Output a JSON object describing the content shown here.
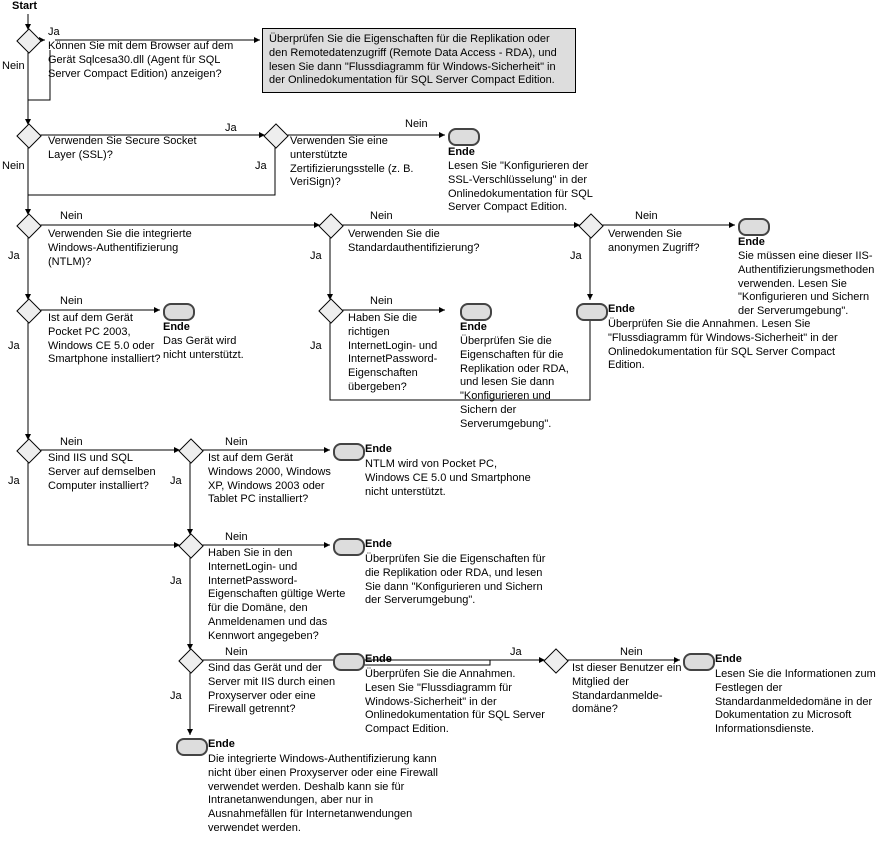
{
  "labels": {
    "start": "Start",
    "ja": "Ja",
    "nein": "Nein",
    "ende": "Ende"
  },
  "nodes": {
    "q1": "Können Sie mit dem Browser auf dem Gerät Sqlcesa30.dll (Agent für SQL Server Compact Edition) anzeigen?",
    "box1": "Überprüfen Sie die Eigenschaften für die Replikation oder den Remotedatenzugriff (Remote Data Access - RDA), und lesen Sie dann \"Flussdiagramm für Windows-Sicherheit\" in der Onlinedokumentation für SQL Server Compact Edition.",
    "q2": "Verwenden Sie Secure Socket Layer (SSL)?",
    "q3": "Verwenden Sie eine unterstützte Zertifizierungsstelle (z. B. VeriSign)?",
    "e1": "Lesen Sie \"Konfigurieren der SSL-Verschlüsselung\" in der Onlinedokumentation für SQL Server Compact Edition.",
    "q4": "Verwenden Sie die integrierte Windows-Authentifizierung (NTLM)?",
    "q5": "Verwenden Sie die Standardauthentifizierung?",
    "q6": "Verwenden Sie anonymen Zugriff?",
    "e2": "Sie müssen eine dieser IIS-Authentifizierungsmethoden verwenden. Lesen Sie \"Konfigurieren und Sichern der Serverumgebung\".",
    "q7": "Ist auf dem Gerät Pocket PC 2003, Windows CE 5.0 oder Smartphone installiert?",
    "e3": "Das Gerät wird nicht unterstützt.",
    "q8": "Haben Sie die richtigen InternetLogin- und InternetPassword-Eigenschaften übergeben?",
    "e4": "Überprüfen Sie die Eigenschaften für die Replikation oder RDA, und lesen Sie dann \"Konfigurieren und Sichern der Serverumgebung\".",
    "e5": "Überprüfen Sie die Annahmen. Lesen Sie \"Flussdiagramm für Windows-Sicherheit\" in der Onlinedokumentation für SQL Server Compact Edition.",
    "q9": "Sind IIS und SQL Server auf demselben Computer installiert?",
    "q10": "Ist auf dem Gerät Windows 2000, Windows XP, Windows 2003 oder Tablet PC installiert?",
    "e6": "NTLM wird von Pocket PC, Windows CE 5.0 und Smartphone nicht unterstützt.",
    "q11": "Haben Sie in den InternetLogin- und InternetPassword-Eigenschaften gültige Werte für die Domäne, den Anmeldenamen und das Kennwort angegeben?",
    "e7": "Überprüfen Sie die Eigenschaften für die Replikation oder RDA, und lesen Sie dann \"Konfigurieren und Sichern der Serverumgebung\".",
    "q12": "Sind das Gerät und der Server mit IIS durch einen Proxyserver oder eine Firewall getrennt?",
    "q13": "Ist dieser Benutzer ein Mitglied der Standardanmelde­domäne?",
    "e8": "Überprüfen Sie die Annahmen. Lesen Sie \"Flussdiagramm für Windows-Sicherheit\" in der Onlinedokumentation für SQL Server Compact Edition.",
    "e9": "Lesen Sie die Informationen zum Festlegen der Standardanmeldedomäne in der Dokumentation zu Microsoft Informationsdienste.",
    "e10": "Die integrierte Windows-Authentifizierung kann nicht über einen Proxyserver oder eine Firewall verwendet werden. Deshalb kann sie für Intranetanwendungen, aber nur in Ausnahmefällen für Internetanwendungen verwendet werden."
  },
  "chart_data": {
    "type": "flowchart",
    "title": "Flussdiagramm für Windows-Sicherheit (SQL Server Compact Edition)",
    "nodes": [
      {
        "id": "start",
        "kind": "start",
        "label": "Start"
      },
      {
        "id": "d0",
        "kind": "decision",
        "label": ""
      },
      {
        "id": "q1",
        "kind": "decision",
        "label": "Können Sie mit dem Browser auf dem Gerät Sqlcesa30.dll (Agent für SQL Server Compact Edition) anzeigen?"
      },
      {
        "id": "box1",
        "kind": "process",
        "label": "Überprüfen Sie die Eigenschaften für die Replikation oder den Remotedatenzugriff (Remote Data Access - RDA), und lesen Sie dann \"Flussdiagramm für Windows-Sicherheit\" in der Onlinedokumentation für SQL Server Compact Edition."
      },
      {
        "id": "q2",
        "kind": "decision",
        "label": "Verwenden Sie Secure Socket Layer (SSL)?"
      },
      {
        "id": "q3",
        "kind": "decision",
        "label": "Verwenden Sie eine unterstützte Zertifizierungsstelle (z. B. VeriSign)?"
      },
      {
        "id": "e1",
        "kind": "terminator",
        "label": "Ende",
        "note": "Lesen Sie \"Konfigurieren der SSL-Verschlüsselung\" in der Onlinedokumentation für SQL Server Compact Edition."
      },
      {
        "id": "q4",
        "kind": "decision",
        "label": "Verwenden Sie die integrierte Windows-Authentifizierung (NTLM)?"
      },
      {
        "id": "q5",
        "kind": "decision",
        "label": "Verwenden Sie die Standardauthentifizierung?"
      },
      {
        "id": "q6",
        "kind": "decision",
        "label": "Verwenden Sie anonymen Zugriff?"
      },
      {
        "id": "e2",
        "kind": "terminator",
        "label": "Ende",
        "note": "Sie müssen eine dieser IIS-Authentifizierungsmethoden verwenden. Lesen Sie \"Konfigurieren und Sichern der Serverumgebung\"."
      },
      {
        "id": "q7",
        "kind": "decision",
        "label": "Ist auf dem Gerät Pocket PC 2003, Windows CE 5.0 oder Smartphone installiert?"
      },
      {
        "id": "e3",
        "kind": "terminator",
        "label": "Ende",
        "note": "Das Gerät wird nicht unterstützt."
      },
      {
        "id": "q8",
        "kind": "decision",
        "label": "Haben Sie die richtigen InternetLogin- und InternetPassword-Eigenschaften übergeben?"
      },
      {
        "id": "e4",
        "kind": "terminator",
        "label": "Ende",
        "note": "Überprüfen Sie die Eigenschaften für die Replikation oder RDA, und lesen Sie dann \"Konfigurieren und Sichern der Serverumgebung\"."
      },
      {
        "id": "e5",
        "kind": "terminator",
        "label": "Ende",
        "note": "Überprüfen Sie die Annahmen. Lesen Sie \"Flussdiagramm für Windows-Sicherheit\" in der Onlinedokumentation für SQL Server Compact Edition."
      },
      {
        "id": "q9",
        "kind": "decision",
        "label": "Sind IIS und SQL Server auf demselben Computer installiert?"
      },
      {
        "id": "q10",
        "kind": "decision",
        "label": "Ist auf dem Gerät Windows 2000, Windows XP, Windows 2003 oder Tablet PC installiert?"
      },
      {
        "id": "e6",
        "kind": "terminator",
        "label": "Ende",
        "note": "NTLM wird von Pocket PC, Windows CE 5.0 und Smartphone nicht unterstützt."
      },
      {
        "id": "q11",
        "kind": "decision",
        "label": "Haben Sie in den InternetLogin- und InternetPassword-Eigenschaften gültige Werte für die Domäne, den Anmeldenamen und das Kennwort angegeben?"
      },
      {
        "id": "e7",
        "kind": "terminator",
        "label": "Ende",
        "note": "Überprüfen Sie die Eigenschaften für die Replikation oder RDA, und lesen Sie dann \"Konfigurieren und Sichern der Serverumgebung\"."
      },
      {
        "id": "q12",
        "kind": "decision",
        "label": "Sind das Gerät und der Server mit IIS durch einen Proxyserver oder eine Firewall getrennt?"
      },
      {
        "id": "q13",
        "kind": "decision",
        "label": "Ist dieser Benutzer ein Mitglied der Standardanmeldedomäne?"
      },
      {
        "id": "e8",
        "kind": "terminator",
        "label": "Ende",
        "note": "Überprüfen Sie die Annahmen. Lesen Sie \"Flussdiagramm für Windows-Sicherheit\" in der Onlinedokumentation für SQL Server Compact Edition."
      },
      {
        "id": "e9",
        "kind": "terminator",
        "label": "Ende",
        "note": "Lesen Sie die Informationen zum Festlegen der Standardanmeldedomäne in der Dokumentation zu Microsoft Informationsdienste."
      },
      {
        "id": "e10",
        "kind": "terminator",
        "label": "Ende",
        "note": "Die integrierte Windows-Authentifizierung kann nicht über einen Proxyserver oder eine Firewall verwendet werden. Deshalb kann sie für Intranetanwendungen, aber nur in Ausnahmefällen für Internetanwendungen verwendet werden."
      }
    ],
    "edges": [
      {
        "from": "start",
        "to": "d0"
      },
      {
        "from": "d0",
        "to": "q1",
        "label": "Ja"
      },
      {
        "from": "d0",
        "to": "q2",
        "label": "Nein"
      },
      {
        "from": "q1",
        "to": "box1",
        "label": "Ja"
      },
      {
        "from": "q1",
        "to": "q2",
        "label": "Nein"
      },
      {
        "from": "q2",
        "to": "q3",
        "label": "Ja"
      },
      {
        "from": "q2",
        "to": "q4",
        "label": "Nein"
      },
      {
        "from": "q3",
        "to": "e1",
        "label": "Nein"
      },
      {
        "from": "q3",
        "to": "q4",
        "label": "Ja"
      },
      {
        "from": "q4",
        "to": "q7",
        "label": "Ja"
      },
      {
        "from": "q4",
        "to": "q5",
        "label": "Nein"
      },
      {
        "from": "q5",
        "to": "q8",
        "label": "Ja"
      },
      {
        "from": "q5",
        "to": "q6",
        "label": "Nein"
      },
      {
        "from": "q6",
        "to": "e5",
        "label": "Ja"
      },
      {
        "from": "q6",
        "to": "e2",
        "label": "Nein"
      },
      {
        "from": "q7",
        "to": "q9",
        "label": "Ja"
      },
      {
        "from": "q7",
        "to": "e3",
        "label": "Nein"
      },
      {
        "from": "q8",
        "to": "e5",
        "label": "Ja"
      },
      {
        "from": "q8",
        "to": "e4",
        "label": "Nein"
      },
      {
        "from": "q9",
        "to": "q11",
        "label": "Ja"
      },
      {
        "from": "q9",
        "to": "q10",
        "label": "Nein"
      },
      {
        "from": "q10",
        "to": "q11",
        "label": "Ja"
      },
      {
        "from": "q10",
        "to": "e6",
        "label": "Nein"
      },
      {
        "from": "q11",
        "to": "q12",
        "label": "Ja"
      },
      {
        "from": "q11",
        "to": "e7",
        "label": "Nein"
      },
      {
        "from": "q12",
        "to": "e10",
        "label": "Ja"
      },
      {
        "from": "q12",
        "to": "q13",
        "label": "Nein"
      },
      {
        "from": "q13",
        "to": "e8",
        "label": "Ja"
      },
      {
        "from": "q13",
        "to": "e9",
        "label": "Nein"
      }
    ]
  }
}
